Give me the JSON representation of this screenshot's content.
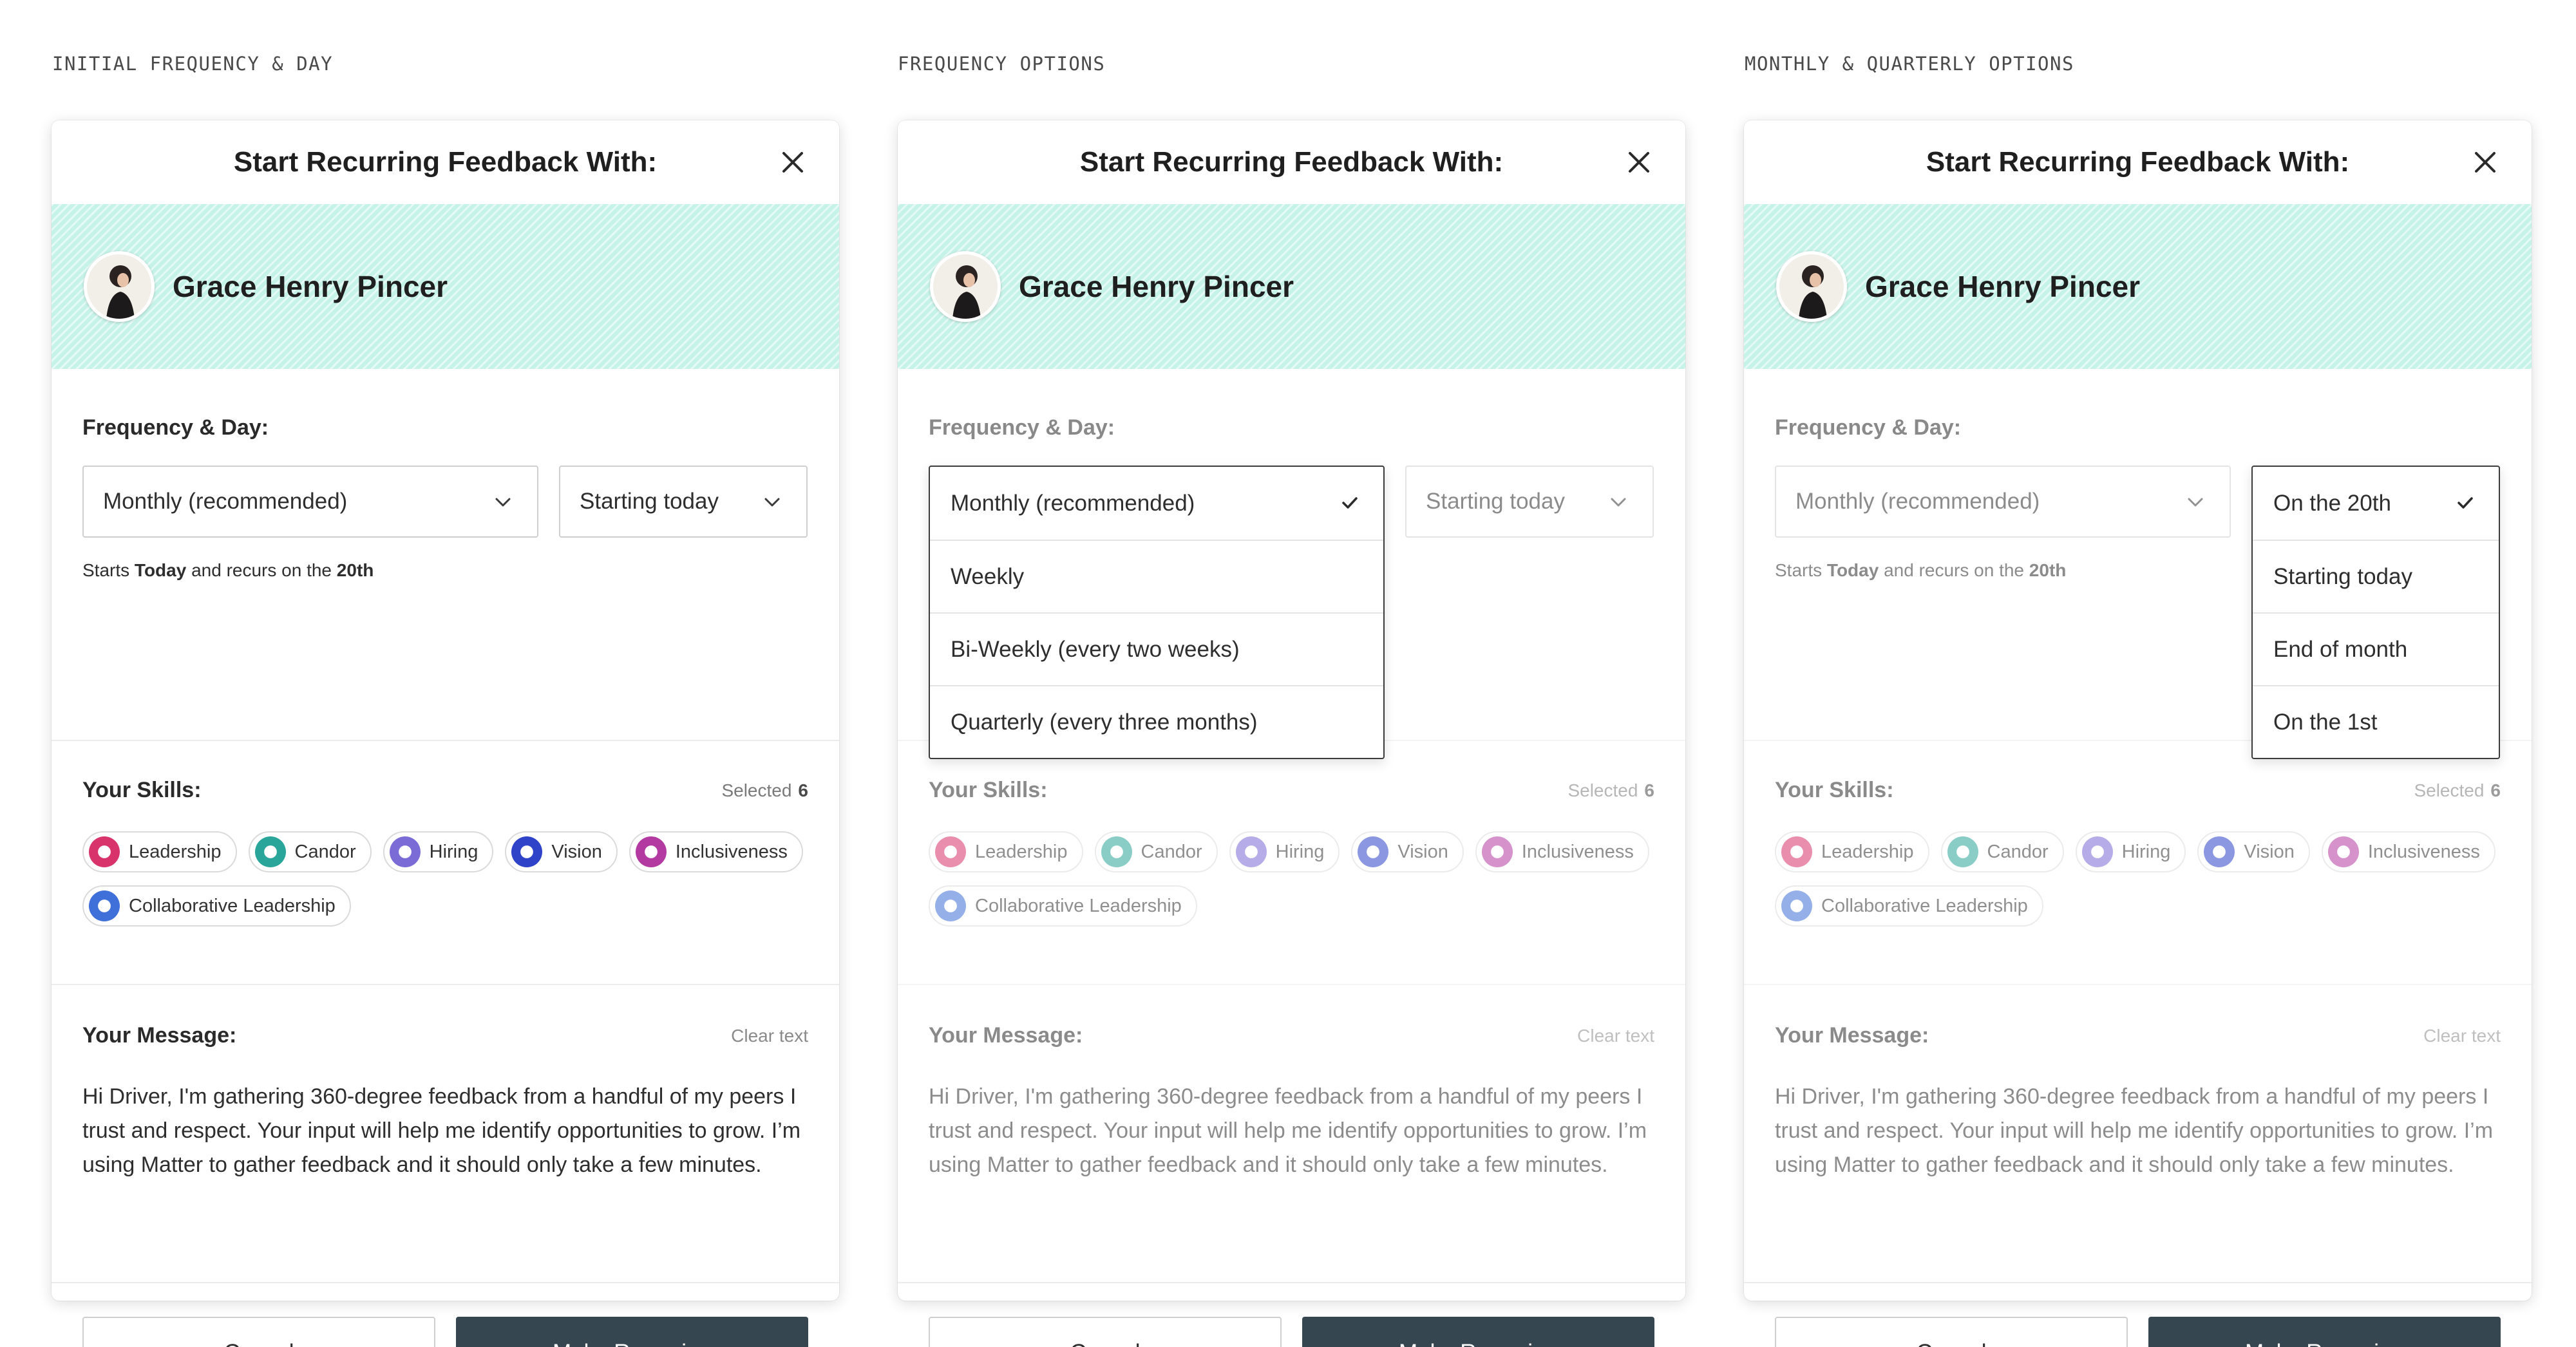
{
  "column_labels": [
    "INITIAL FREQUENCY & DAY",
    "FREQUENCY OPTIONS",
    "MONTHLY & QUARTERLY OPTIONS"
  ],
  "modal": {
    "title": "Start Recurring Feedback With:",
    "user_name": "Grace Henry Pincer",
    "frequency_label": "Frequency & Day:",
    "frequency_value": "Monthly (recommended)",
    "day_value": "Starting today",
    "starts_note": {
      "prefix": "Starts ",
      "day": "Today",
      "middle": " and recurs on the ",
      "date": "20th"
    },
    "skills_label": "Your Skills:",
    "selected_label": "Selected",
    "selected_count": "6",
    "skills": [
      {
        "label": "Leadership",
        "color": "#d8336b"
      },
      {
        "label": "Candor",
        "color": "#2aa59a"
      },
      {
        "label": "Hiring",
        "color": "#7b6bd6"
      },
      {
        "label": "Vision",
        "color": "#2f43c9"
      },
      {
        "label": "Inclusiveness",
        "color": "#b23aa0"
      },
      {
        "label": "Collaborative Leadership",
        "color": "#3f6fd8"
      }
    ],
    "message_label": "Your Message:",
    "clear_text": "Clear text",
    "message": "Hi Driver, I'm gathering 360-degree feedback from a handful of my peers I trust and respect. Your input will help me identify opportunities to grow. I’m using Matter to gather feedback and it should only take a few minutes.",
    "cancel_label": "Cancel",
    "primary_label": "Make Recurring"
  },
  "frequency_options": [
    "Monthly (recommended)",
    "Weekly",
    "Bi-Weekly (every two weeks)",
    "Quarterly (every three months)"
  ],
  "day_options": [
    "On the 20th",
    "Starting today",
    "End of month",
    "On the 1st"
  ],
  "colors": {
    "banner": "#c6f3e8",
    "primary_button": "#354651"
  }
}
